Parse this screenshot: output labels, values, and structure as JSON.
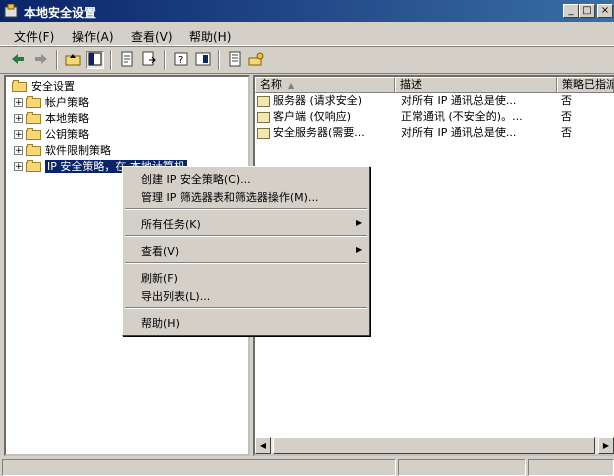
{
  "window": {
    "title": "本地安全设置"
  },
  "menubar": {
    "items": [
      {
        "label": "文件(F)"
      },
      {
        "label": "操作(A)"
      },
      {
        "label": "查看(V)"
      },
      {
        "label": "帮助(H)"
      }
    ]
  },
  "toolbar": {
    "icons": [
      "back-icon",
      "forward-icon",
      "up-level-icon",
      "show-hide-tree-icon",
      "properties-icon",
      "refresh-icon",
      "export-list-icon",
      "help-icon",
      "console-icon",
      "policy-icon",
      "ipsec-icon"
    ]
  },
  "tree": {
    "root": "安全设置",
    "items": [
      {
        "label": "帐户策略"
      },
      {
        "label": "本地策略"
      },
      {
        "label": "公钥策略"
      },
      {
        "label": "软件限制策略"
      },
      {
        "label": "IP 安全策略，在 本地计算机"
      }
    ]
  },
  "list": {
    "columns": [
      "名称",
      "描述",
      "策略已指派"
    ],
    "rows": [
      {
        "name": "服务器 (请求安全)",
        "description": "对所有 IP 通讯总是使...",
        "assigned": "否"
      },
      {
        "name": "客户端 (仅响应)",
        "description": "正常通讯 (不安全的)。...",
        "assigned": "否"
      },
      {
        "name": "安全服务器(需要...",
        "description": "对所有 IP 通讯总是使...",
        "assigned": "否"
      }
    ]
  },
  "context_menu": {
    "create_policy": "创建 IP 安全策略(C)...",
    "manage_filters": "管理 IP 筛选器表和筛选器操作(M)...",
    "all_tasks": "所有任务(K)",
    "view": "查看(V)",
    "refresh": "刷新(F)",
    "export_list": "导出列表(L)...",
    "help": "帮助(H)"
  },
  "colors": {
    "title_bar": "#0a246a",
    "selection": "#0a246a",
    "face": "#d4d0c8"
  }
}
